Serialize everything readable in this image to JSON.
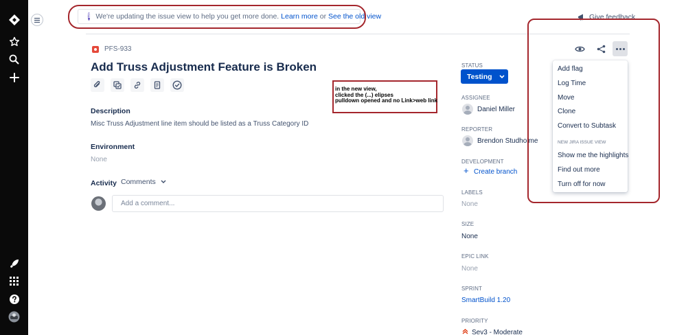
{
  "banner": {
    "message": "We're updating the issue view to help you get more done.",
    "learn_more": "Learn more",
    "or": "or",
    "old_view": "See the old view"
  },
  "header": {
    "feedback_label": "Give feedback"
  },
  "issue": {
    "key": "PFS-933",
    "title": "Add Truss Adjustment Feature is Broken",
    "description_label": "Description",
    "description": "Misc Truss Adjustment line item should be listed as a Truss Category ID",
    "environment_label": "Environment",
    "environment_value": "None",
    "activity_label": "Activity",
    "activity_filter": "Comments",
    "comment_placeholder": "Add a comment..."
  },
  "annotation": {
    "lines": [
      "in the new view,",
      "clicked the (...) elipses",
      "pulldown opened and no Link>web link"
    ]
  },
  "sidebar_fields": {
    "status_label": "STATUS",
    "status_value": "Testing",
    "assignee_label": "ASSIGNEE",
    "assignee": "Daniel Miller",
    "reporter_label": "REPORTER",
    "reporter": "Brendon Studholme",
    "development_label": "DEVELOPMENT",
    "create_branch": "Create branch",
    "labels_label": "LABELS",
    "labels_value": "None",
    "size_label": "SIZE",
    "size_value": "None",
    "epic_label": "EPIC LINK",
    "epic_value": "None",
    "sprint_label": "SPRINT",
    "sprint_value": "SmartBuild 1.20",
    "priority_label": "PRIORITY",
    "priority_value": "Sev3 - Moderate"
  },
  "more_menu": {
    "items": [
      "Add flag",
      "Log Time",
      "Move",
      "Clone",
      "Convert to Subtask"
    ],
    "section_header": "NEW JIRA ISSUE VIEW",
    "section_items": [
      "Show me the highlights",
      "Find out more",
      "Turn off for now"
    ]
  },
  "colors": {
    "nav_bg": "#0a0a0a",
    "primary": "#0052cc",
    "annotation_red": "#a4262c",
    "bug_red": "#e5493a",
    "info_purple": "#6554c0"
  },
  "icons": {
    "global_nav": [
      "jira-logo-icon",
      "star-icon",
      "search-icon",
      "create-plus-icon",
      "rocket-icon",
      "app-switcher-icon",
      "help-icon",
      "profile-avatar"
    ],
    "toolbar": [
      "attachment-icon",
      "subtask-icon",
      "link-icon",
      "confluence-page-icon",
      "checklist-icon"
    ],
    "actions": [
      "watch-eye-icon",
      "share-icon",
      "more-ellipsis-icon"
    ]
  }
}
